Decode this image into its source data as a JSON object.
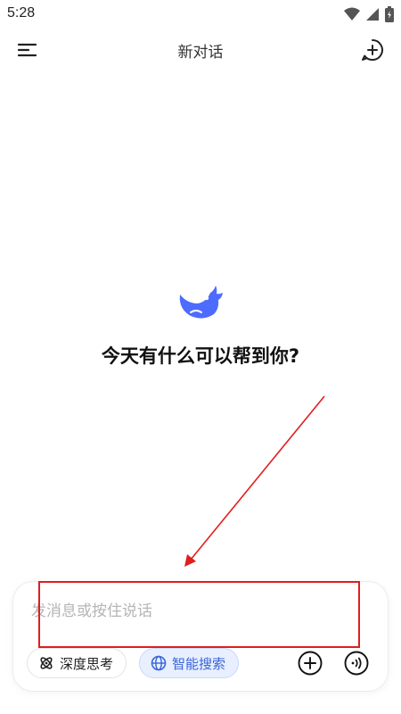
{
  "status_bar": {
    "time": "5:28",
    "icons": [
      "wifi-icon",
      "cellular-signal-icon",
      "battery-icon"
    ]
  },
  "header": {
    "title": "新对话",
    "menu_icon": "menu-icon",
    "new_chat_icon": "new-chat-icon"
  },
  "hero": {
    "logo": "whale-logo",
    "greeting": "今天有什么可以帮到你?"
  },
  "composer": {
    "placeholder": "发消息或按住说话",
    "value": "",
    "chips": [
      {
        "label": "深度思考",
        "icon": "atom-icon",
        "active": false
      },
      {
        "label": "智能搜索",
        "icon": "globe-icon",
        "active": true
      }
    ],
    "attach_icon": "plus-circle-icon",
    "voice_icon": "voice-wave-icon"
  },
  "colors": {
    "brand_blue": "#4d6bfe",
    "chip_active_bg": "#e8effe",
    "chip_active_text": "#3a64d8",
    "annotation_red": "#e11d1d"
  }
}
